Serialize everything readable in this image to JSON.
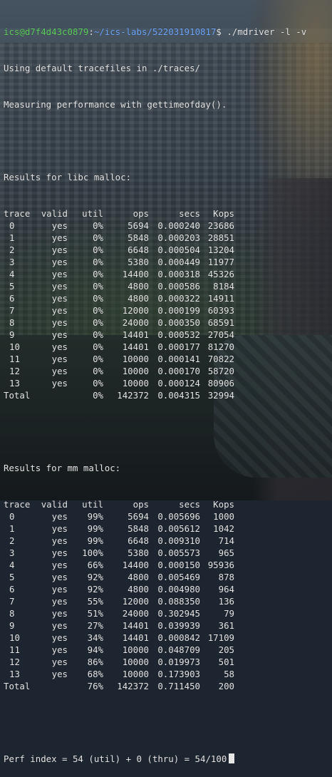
{
  "prompt": {
    "user_host": "ics@d7f4d43c0879",
    "path": "~/ics-labs/522031910817",
    "command": "$ ./mdriver -l -v"
  },
  "intro": [
    "Using default tracefiles in ./traces/",
    "Measuring performance with gettimeofday()."
  ],
  "libc": {
    "title": "Results for libc malloc:",
    "header": [
      "trace",
      "valid",
      "util",
      "ops",
      "secs",
      "Kops"
    ],
    "rows": [
      [
        "0",
        "yes",
        "0%",
        "5694",
        "0.000240",
        "23686"
      ],
      [
        "1",
        "yes",
        "0%",
        "5848",
        "0.000203",
        "28851"
      ],
      [
        "2",
        "yes",
        "0%",
        "6648",
        "0.000504",
        "13204"
      ],
      [
        "3",
        "yes",
        "0%",
        "5380",
        "0.000449",
        "11977"
      ],
      [
        "4",
        "yes",
        "0%",
        "14400",
        "0.000318",
        "45326"
      ],
      [
        "5",
        "yes",
        "0%",
        "4800",
        "0.000586",
        "8184"
      ],
      [
        "6",
        "yes",
        "0%",
        "4800",
        "0.000322",
        "14911"
      ],
      [
        "7",
        "yes",
        "0%",
        "12000",
        "0.000199",
        "60393"
      ],
      [
        "8",
        "yes",
        "0%",
        "24000",
        "0.000350",
        "68591"
      ],
      [
        "9",
        "yes",
        "0%",
        "14401",
        "0.000532",
        "27054"
      ],
      [
        "10",
        "yes",
        "0%",
        "14401",
        "0.000177",
        "81270"
      ],
      [
        "11",
        "yes",
        "0%",
        "10000",
        "0.000141",
        "70822"
      ],
      [
        "12",
        "yes",
        "0%",
        "10000",
        "0.000170",
        "58720"
      ],
      [
        "13",
        "yes",
        "0%",
        "10000",
        "0.000124",
        "80906"
      ]
    ],
    "total": [
      "Total",
      "",
      "0%",
      "142372",
      "0.004315",
      "32994"
    ]
  },
  "mm": {
    "title": "Results for mm malloc:",
    "header": [
      "trace",
      "valid",
      "util",
      "ops",
      "secs",
      "Kops"
    ],
    "rows": [
      [
        "0",
        "yes",
        "99%",
        "5694",
        "0.005696",
        "1000"
      ],
      [
        "1",
        "yes",
        "99%",
        "5848",
        "0.005612",
        "1042"
      ],
      [
        "2",
        "yes",
        "99%",
        "6648",
        "0.009310",
        "714"
      ],
      [
        "3",
        "yes",
        "100%",
        "5380",
        "0.005573",
        "965"
      ],
      [
        "4",
        "yes",
        "66%",
        "14400",
        "0.000150",
        "95936"
      ],
      [
        "5",
        "yes",
        "92%",
        "4800",
        "0.005469",
        "878"
      ],
      [
        "6",
        "yes",
        "92%",
        "4800",
        "0.004980",
        "964"
      ],
      [
        "7",
        "yes",
        "55%",
        "12000",
        "0.088350",
        "136"
      ],
      [
        "8",
        "yes",
        "51%",
        "24000",
        "0.302945",
        "79"
      ],
      [
        "9",
        "yes",
        "27%",
        "14401",
        "0.039939",
        "361"
      ],
      [
        "10",
        "yes",
        "34%",
        "14401",
        "0.000842",
        "17109"
      ],
      [
        "11",
        "yes",
        "94%",
        "10000",
        "0.048709",
        "205"
      ],
      [
        "12",
        "yes",
        "86%",
        "10000",
        "0.019973",
        "501"
      ],
      [
        "13",
        "yes",
        "68%",
        "10000",
        "0.173903",
        "58"
      ]
    ],
    "total": [
      "Total",
      "",
      "76%",
      "142372",
      "0.711450",
      "200"
    ]
  },
  "perf": "Perf index = 54 (util) + 0 (thru) = 54/100"
}
